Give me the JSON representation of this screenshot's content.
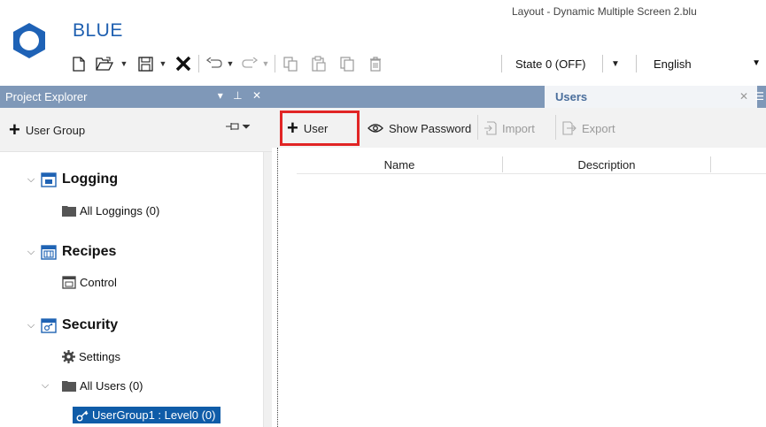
{
  "app": {
    "brand": "BLUE",
    "window_title": "Layout - Dynamic Multiple Screen 2.blu"
  },
  "toolbar": {
    "items": [
      "new-file-icon",
      "open-folder-icon",
      "save-icon",
      "close-icon",
      "undo-icon",
      "redo-icon",
      "copy-icon",
      "paste-icon",
      "duplicate-icon",
      "delete-icon"
    ],
    "state_value": "State 0 (OFF)",
    "language_value": "English"
  },
  "explorer": {
    "title": "Project Explorer",
    "header_icons": "▾ ⊥ ✕",
    "add_group_label": "User Group",
    "tree": {
      "logging": {
        "label": "Logging",
        "child": "All Loggings (0)"
      },
      "recipes": {
        "label": "Recipes",
        "child": "Control"
      },
      "security": {
        "label": "Security",
        "settings": "Settings",
        "all_users": "All Users (0)",
        "group": "UserGroup1 : Level0 (0)"
      }
    }
  },
  "document": {
    "tab_title": "Users",
    "toolbar": {
      "add_user": "User",
      "show_password": "Show Password",
      "import": "Import",
      "export": "Export"
    },
    "columns": [
      "Name",
      "Description"
    ]
  },
  "colors": {
    "accent": "#1e5fb0",
    "panel_header": "#7f98b8",
    "selection": "#0f5ca8",
    "highlight_border": "#e12525"
  }
}
